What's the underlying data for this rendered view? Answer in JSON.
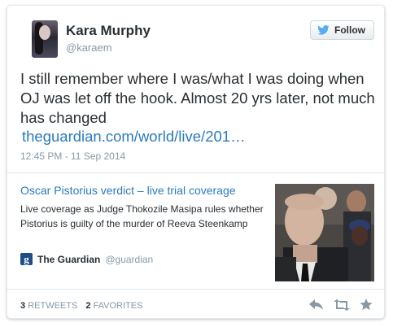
{
  "user": {
    "name": "Kara Murphy",
    "handle": "@karaem"
  },
  "follow_button": {
    "label": "Follow",
    "icon": "twitter-bird-icon"
  },
  "tweet": {
    "text": "I still remember where I was/what I was doing when OJ was let off the hook. Almost 20 yrs later, not much has changed",
    "link": "theguardian.com/world/live/201…",
    "timestamp": "12:45 PM - 11 Sep 2014"
  },
  "summary_card": {
    "title": "Oscar Pistorius verdict – live trial coverage",
    "description": "Live coverage as Judge Thokozile Masipa rules whether Pistorius is guilty of the murder of Reeva Steenkamp",
    "source_logo": "g",
    "source_name": "The Guardian",
    "source_handle": "@guardian"
  },
  "stats": {
    "retweets_count": "3",
    "retweets_label": "RETWEETS",
    "favorites_count": "2",
    "favorites_label": "FAVORITES"
  },
  "actions": [
    "reply-icon",
    "retweet-icon",
    "favorite-star-icon"
  ],
  "colors": {
    "link": "#2b7bb9",
    "muted": "#8899a6",
    "twitter_blue": "#55acee",
    "guardian_blue": "#1d4f86"
  }
}
